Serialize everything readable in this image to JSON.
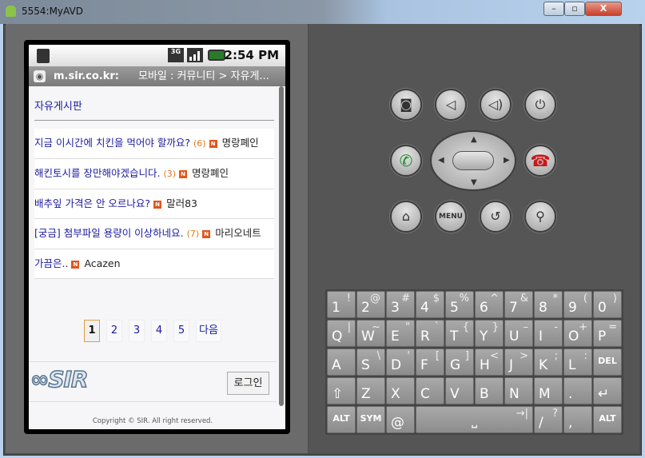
{
  "window": {
    "title": "5554:MyAVD",
    "minimize": "–",
    "maximize": "▫",
    "close": "X"
  },
  "status": {
    "network": "3G",
    "time": "2:54 PM"
  },
  "browser": {
    "host": "m.sir.co.kr:",
    "title": "모바일 : 커뮤니티 > 자유게..."
  },
  "page": {
    "board_title": "자유게시판",
    "posts": [
      {
        "title": "지금 이시간에 치킨을 먹어야 할까요?",
        "comments": "(6)",
        "author": "명랑폐인"
      },
      {
        "title": "해킨토시를 장만해야겠습니다.",
        "comments": "(3)",
        "author": "명랑폐인"
      },
      {
        "title": "배추잎 가격은 안 오르나요?",
        "comments": "",
        "author": "말러83"
      },
      {
        "title": "[궁금] 첨부파일 용량이 이상하네요.",
        "comments": "(7)",
        "author": "마리오네트"
      },
      {
        "title": "가끔은..",
        "comments": "",
        "author": "Acazen"
      }
    ],
    "new_badge": "N",
    "pagination": [
      "1",
      "2",
      "3",
      "4",
      "5",
      "다음"
    ],
    "logo": "∞SIR",
    "login_label": "로그인",
    "copyright": "Copyright © SIR. All right reserved."
  },
  "controls": {
    "menu_label": "MENU"
  },
  "keyboard": {
    "rows": [
      [
        [
          "1",
          "!"
        ],
        [
          "2",
          "@"
        ],
        [
          "3",
          "#"
        ],
        [
          "4",
          "$"
        ],
        [
          "5",
          "%"
        ],
        [
          "6",
          "^"
        ],
        [
          "7",
          "&"
        ],
        [
          "8",
          "*"
        ],
        [
          "9",
          "("
        ],
        [
          "0",
          ")"
        ]
      ],
      [
        [
          "Q",
          "|"
        ],
        [
          "W",
          "~"
        ],
        [
          "E",
          "\""
        ],
        [
          "R",
          "`"
        ],
        [
          "T",
          "{"
        ],
        [
          "Y",
          "}"
        ],
        [
          "U",
          "–"
        ],
        [
          "I",
          "-"
        ],
        [
          "O",
          "+"
        ],
        [
          "P",
          "="
        ]
      ],
      [
        [
          "A",
          ""
        ],
        [
          "S",
          "\\"
        ],
        [
          "D",
          "'"
        ],
        [
          "F",
          "["
        ],
        [
          "G",
          "]"
        ],
        [
          "H",
          "<"
        ],
        [
          "J",
          ">"
        ],
        [
          "K",
          ";"
        ],
        [
          "L",
          ":"
        ],
        [
          "DEL",
          ""
        ]
      ],
      [
        [
          "⇧",
          ""
        ],
        [
          "Z",
          ""
        ],
        [
          "X",
          ""
        ],
        [
          "C",
          ""
        ],
        [
          "V",
          ""
        ],
        [
          "B",
          ""
        ],
        [
          "N",
          ""
        ],
        [
          "M",
          ""
        ],
        [
          ".",
          ""
        ],
        [
          "↵",
          ""
        ]
      ],
      [
        [
          "ALT",
          ""
        ],
        [
          "SYM",
          ""
        ],
        [
          "@",
          ""
        ],
        [
          "␣",
          "→|"
        ],
        [
          "/",
          "?"
        ],
        [
          ",",
          ""
        ],
        [
          "ALT",
          ""
        ]
      ]
    ]
  }
}
